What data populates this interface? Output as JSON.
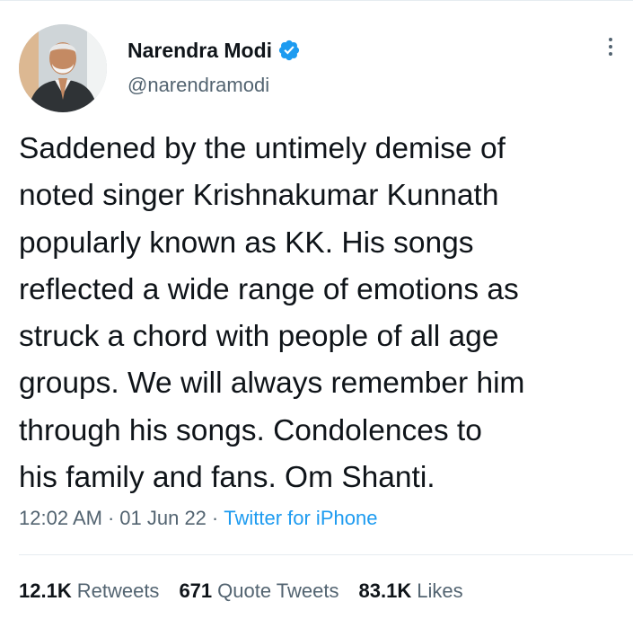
{
  "author": {
    "name": "Narendra Modi",
    "handle": "@narendramodi",
    "verified": true,
    "verified_color": "#1d9bf0"
  },
  "tweet": {
    "lines": [
      "Saddened by the untimely demise of",
      "noted singer Krishnakumar Kunnath",
      "popularly known as KK. His songs",
      "reflected a wide range of emotions as",
      "struck a chord with people of all age",
      "groups. We will always remember him",
      "through his songs. Condolences to",
      "his family and fans. Om Shanti."
    ]
  },
  "meta": {
    "time": "12:02 AM",
    "separator": "·",
    "date": "01 Jun 22",
    "source": "Twitter for iPhone"
  },
  "stats": [
    {
      "count": "12.1K",
      "label": "Retweets"
    },
    {
      "count": "671",
      "label": "Quote Tweets"
    },
    {
      "count": "83.1K",
      "label": "Likes"
    }
  ],
  "icons": {
    "more": "more-vertical-icon",
    "verified": "verified-badge-icon"
  },
  "colors": {
    "text_primary": "#0f1419",
    "text_secondary": "#536471",
    "link": "#1d9bf0",
    "divider": "#e6ecf0"
  }
}
